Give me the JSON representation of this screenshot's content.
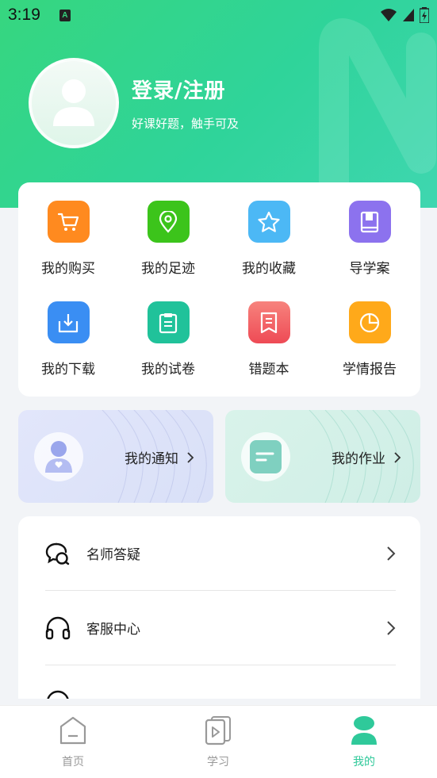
{
  "status_bar": {
    "time": "3:19",
    "notification_glyph": "A"
  },
  "profile": {
    "title": "登录/注册",
    "subtitle": "好课好题，触手可及"
  },
  "grid": [
    {
      "label": "我的购买",
      "icon": "cart-icon",
      "color": "#ff8a1f"
    },
    {
      "label": "我的足迹",
      "icon": "location-pin-icon",
      "color": "#3cc41b"
    },
    {
      "label": "我的收藏",
      "icon": "star-icon",
      "color": "#4cb8f5"
    },
    {
      "label": "导学案",
      "icon": "book-icon",
      "color": "#8c72ee"
    },
    {
      "label": "我的下载",
      "icon": "download-icon",
      "color": "#3a8ef3"
    },
    {
      "label": "我的试卷",
      "icon": "clipboard-icon",
      "color": "#20c29a"
    },
    {
      "label": "错题本",
      "icon": "bookmark-icon",
      "color": "#f0575c"
    },
    {
      "label": "学情报告",
      "icon": "pie-chart-icon",
      "color": "#ffa91a"
    }
  ],
  "promos": {
    "notify_label": "我的通知",
    "homework_label": "我的作业"
  },
  "list": [
    {
      "label": "名师答疑",
      "icon": "chat-bubbles-icon"
    },
    {
      "label": "客服中心",
      "icon": "headphones-icon"
    }
  ],
  "tabbar": [
    {
      "label": "首页",
      "icon": "home-icon",
      "active": false
    },
    {
      "label": "学习",
      "icon": "video-pages-icon",
      "active": false
    },
    {
      "label": "我的",
      "icon": "person-icon",
      "active": true
    }
  ],
  "colors": {
    "brand": "#36d67f",
    "active_tab": "#2fc99a"
  }
}
